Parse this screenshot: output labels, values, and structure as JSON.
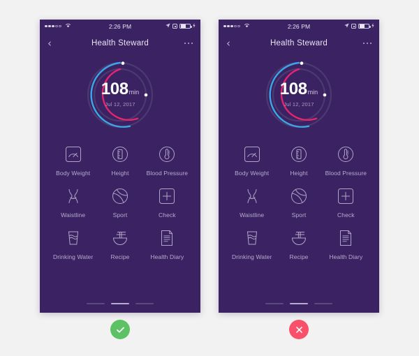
{
  "page": {
    "background_color": "#f2f2f2",
    "phone_background_color": "#3b2363"
  },
  "status_bar": {
    "carrier_signal_dots": 5,
    "carrier_signal_filled": 3,
    "wifi_icon": "wifi-icon",
    "time": "2:26 PM",
    "location_icon": "location-arrow-icon",
    "lock_icon": "rotation-lock-icon",
    "battery_icon": "battery-icon",
    "charging_icon": "bolt-icon"
  },
  "nav_bar": {
    "back_icon": "chevron-left-icon",
    "title": "Health Steward",
    "more_icon": "ellipsis-icon"
  },
  "ring": {
    "value": "108",
    "unit": "min",
    "date": "Jul 12, 2017",
    "outer_track_color": "#4b3a70",
    "outer_progress_color": "#3aa7e8",
    "inner_track_color": "#4b3a70",
    "inner_progress_color": "#e8246e",
    "endpoint_dot_color": "#ffffff",
    "outer_progress_percent": 72,
    "inner_progress_percent": 60
  },
  "grid": {
    "items": [
      {
        "label": "Body Weight",
        "icon": "scale-icon"
      },
      {
        "label": "Height",
        "icon": "ruler-icon"
      },
      {
        "label": "Blood Pressure",
        "icon": "thermometer-icon"
      },
      {
        "label": "Waistline",
        "icon": "waist-icon"
      },
      {
        "label": "Sport",
        "icon": "ball-icon"
      },
      {
        "label": "Check",
        "icon": "plus-square-icon"
      },
      {
        "label": "Drinking Water",
        "icon": "water-glass-icon"
      },
      {
        "label": "Recipe",
        "icon": "noodle-bowl-icon"
      },
      {
        "label": "Health Diary",
        "icon": "document-icon"
      }
    ]
  },
  "pagination": {
    "count": 3,
    "active_index": 1
  },
  "verdicts": {
    "left": {
      "icon": "check-circle-icon",
      "meaning": "correct",
      "color": "#5dc264"
    },
    "right": {
      "icon": "cross-circle-icon",
      "meaning": "incorrect",
      "color": "#f9506b"
    }
  }
}
